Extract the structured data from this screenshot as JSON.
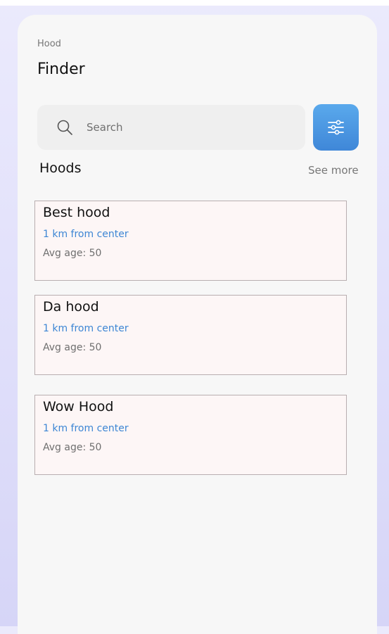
{
  "header": {
    "subtitle": "Hood",
    "title": "Finder"
  },
  "search": {
    "placeholder": "Search",
    "icon": "search-icon"
  },
  "filter": {
    "icon": "sliders-icon",
    "color": "#4a97e2"
  },
  "section": {
    "title": "Hoods",
    "see_more": "See more"
  },
  "hoods": [
    {
      "name": "Best hood",
      "distance": "1 km from center",
      "age": "Avg age: 50"
    },
    {
      "name": "Da hood",
      "distance": "1 km from center",
      "age": "Avg age: 50"
    },
    {
      "name": "Wow Hood",
      "distance": "1 km from center",
      "age": "Avg age: 50"
    }
  ],
  "colors": {
    "accent": "#3d86d4",
    "card_background": "#fdf6f6",
    "page_background": "#f7f7f7",
    "backdrop": "#e2e1fb"
  }
}
